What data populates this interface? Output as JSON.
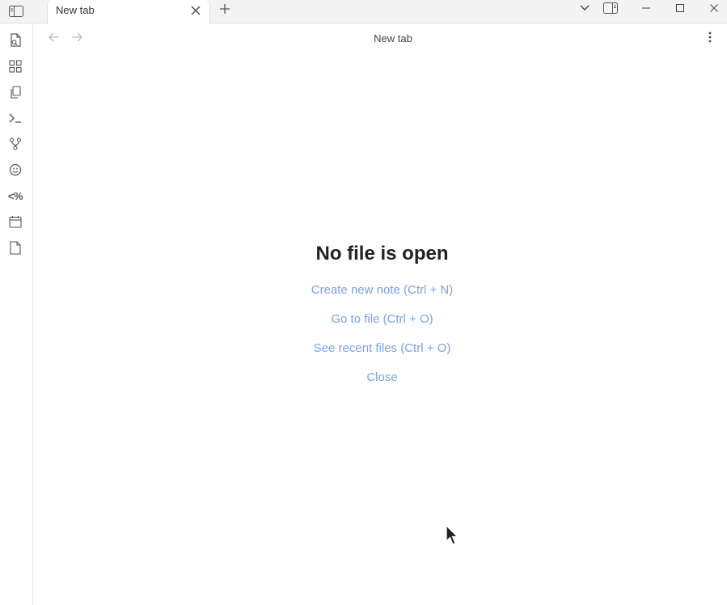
{
  "tab": {
    "title": "New tab"
  },
  "header": {
    "title": "New tab"
  },
  "ribbon": {
    "items": [
      {
        "name": "open-quick-switcher-icon"
      },
      {
        "name": "graph-view-icon"
      },
      {
        "name": "files-icon"
      },
      {
        "name": "terminal-icon"
      },
      {
        "name": "git-icon"
      },
      {
        "name": "smile-icon"
      },
      {
        "name": "templater-icon",
        "text": "<%"
      },
      {
        "name": "calendar-icon"
      },
      {
        "name": "page-icon"
      }
    ]
  },
  "empty_state": {
    "title": "No file is open",
    "actions": [
      "Create new note (Ctrl + N)",
      "Go to file (Ctrl + O)",
      "See recent files (Ctrl + O)",
      "Close"
    ]
  },
  "colors": {
    "link": "#7aa3e3",
    "chrome": "#f3f3f3"
  }
}
